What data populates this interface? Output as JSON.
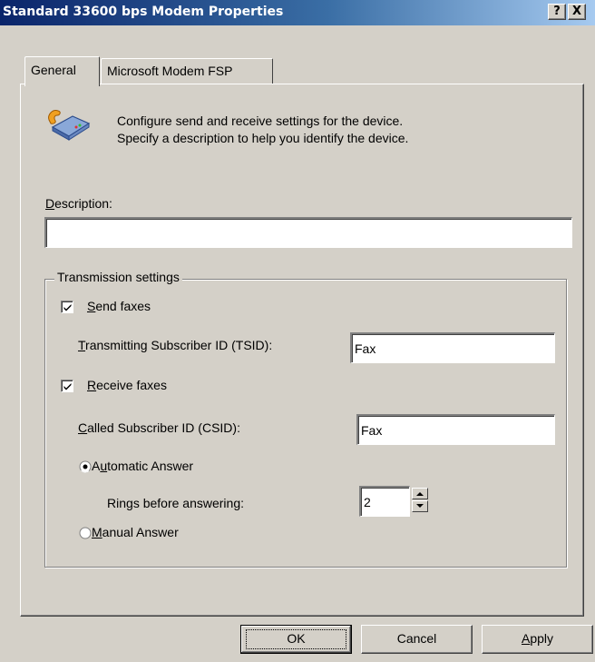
{
  "window": {
    "title": "Standard 33600 bps Modem Properties",
    "help_button": "?",
    "close_button": "X"
  },
  "tabs": [
    {
      "label": "General",
      "selected": true
    },
    {
      "label": "Microsoft Modem FSP",
      "selected": false
    }
  ],
  "intro": {
    "icon": "modem-icon",
    "line1": "Configure send and receive settings for the device.",
    "line2": "Specify a description to help you identify the device."
  },
  "description": {
    "label_key": "D",
    "label_rest": "escription:",
    "value": ""
  },
  "transmission": {
    "group_label": "Transmission settings",
    "send_faxes": {
      "key": "S",
      "rest": "end faxes",
      "checked": true
    },
    "tsid": {
      "key": "T",
      "rest": "ransmitting Subscriber ID (TSID):",
      "value": "Fax"
    },
    "receive_faxes": {
      "key": "R",
      "rest": "eceive faxes",
      "checked": true
    },
    "csid": {
      "key": "C",
      "rest": "alled Subscriber ID (CSID):",
      "value": "Fax"
    },
    "automatic_answer": {
      "pre": "A",
      "key": "u",
      "rest": "tomatic Answer",
      "selected": true
    },
    "rings": {
      "pre": "Rin",
      "key": "g",
      "rest": "s before answering:",
      "value": "2"
    },
    "manual_answer": {
      "key": "M",
      "rest": "anual Answer",
      "selected": false
    }
  },
  "buttons": {
    "ok": "OK",
    "cancel": "Cancel",
    "apply_key": "A",
    "apply_rest": "pply"
  },
  "colors": {
    "face": "#d4d0c8",
    "title_start": "#0a246a",
    "title_end": "#a6caf0"
  }
}
